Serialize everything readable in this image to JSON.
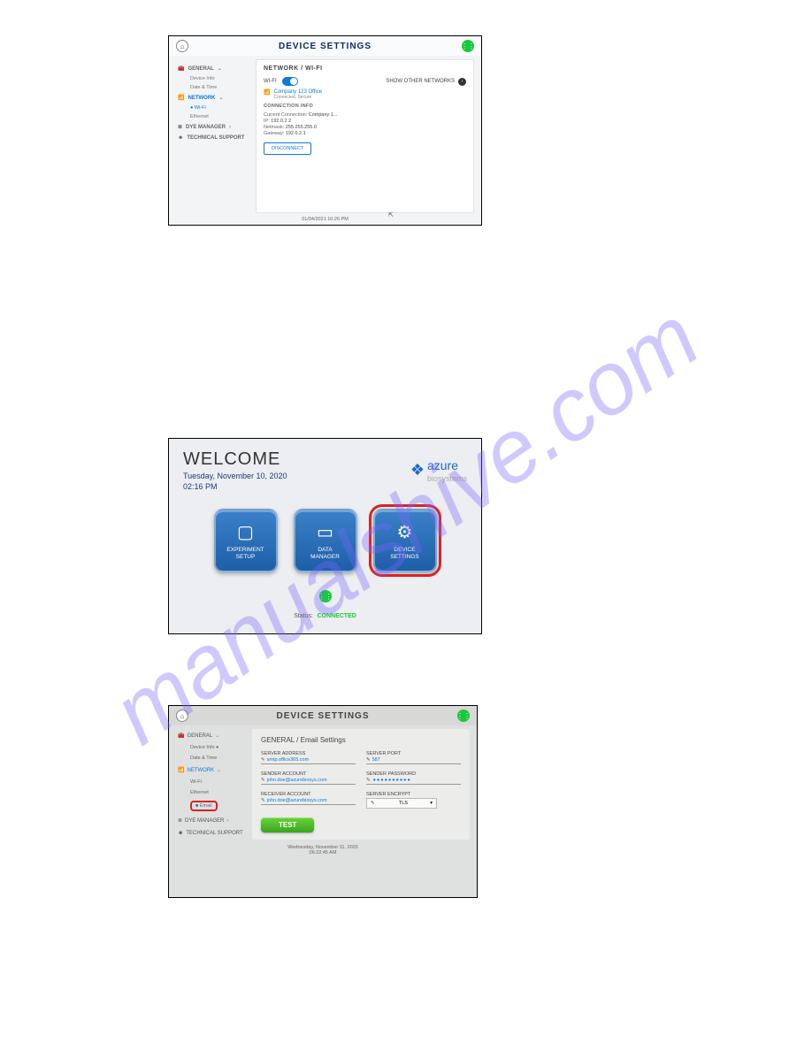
{
  "watermark": "manualshive.com",
  "screenshot1": {
    "title": "DEVICE SETTINGS",
    "sidebar": {
      "general": "GENERAL",
      "device_info": "Device Info",
      "date_time": "Date & Time",
      "network": "NETWORK",
      "wifi": "Wi-Fi",
      "ethernet": "Ethernet",
      "dye_manager": "DYE MANAGER",
      "technical_support": "TECHNICAL SUPPORT"
    },
    "panel": {
      "heading": "NETWORK / WI-FI",
      "wifi_label": "WI-FI",
      "show_other": "SHOW OTHER NETWORKS",
      "network_name": "Company 123 Office",
      "network_status": "Connected, Secure",
      "conn_info_label": "CONNECTION INFO",
      "current_label": "Current Connection:",
      "current_val": "Company 1...",
      "ip_label": "IP:",
      "ip_val": "192.0.2.2",
      "netmask_label": "Netmask:",
      "netmask_val": "255.255.255.0",
      "gateway_label": "Gateway:",
      "gateway_val": "192.0.2.1",
      "disconnect": "DISCONNECT"
    },
    "timestamp": "01/04/2021 10:26 PM"
  },
  "screenshot2": {
    "welcome": "WELCOME",
    "date_line": "Tuesday, November 10, 2020",
    "time_line": "02:16 PM",
    "logo_main": "azure",
    "logo_sub": "biosystems",
    "buttons": {
      "experiment": "EXPERIMENT\nSETUP",
      "data_manager": "DATA\nMANAGER",
      "device_settings": "DEVICE\nSETTINGS"
    },
    "status_label": "Status:",
    "status_val": "CONNECTED"
  },
  "screenshot3": {
    "title": "DEVICE SETTINGS",
    "sidebar": {
      "general": "GENERAL",
      "device_info": "Device Info",
      "date_time": "Date & Time",
      "network": "NETWORK",
      "wifi": "Wi-Fi",
      "ethernet": "Ethernet",
      "email": "Email",
      "dye_manager": "DYE MANAGER",
      "technical_support": "TECHNICAL SUPPORT"
    },
    "panel": {
      "heading": "GENERAL / Email Settings",
      "server_address_label": "SERVER ADDRESS",
      "server_address_val": "smtp.office365.com",
      "server_port_label": "SERVER PORT",
      "server_port_val": "587",
      "sender_account_label": "SENDER ACCOUNT",
      "sender_account_val": "john.doe@azurebiosys.com",
      "sender_password_label": "SENDER PASSWORD",
      "sender_password_val": "●●●●●●●●●●",
      "receiver_account_label": "RECEIVER ACCOUNT",
      "receiver_account_val": "john.doe@azurebiosys.com",
      "server_encrypt_label": "SERVER ENCRYPT",
      "server_encrypt_val": "TLS",
      "test": "TEST"
    },
    "timestamp_line1": "Wednesday, November 11, 2020",
    "timestamp_line2": "06:22:45 AM"
  }
}
